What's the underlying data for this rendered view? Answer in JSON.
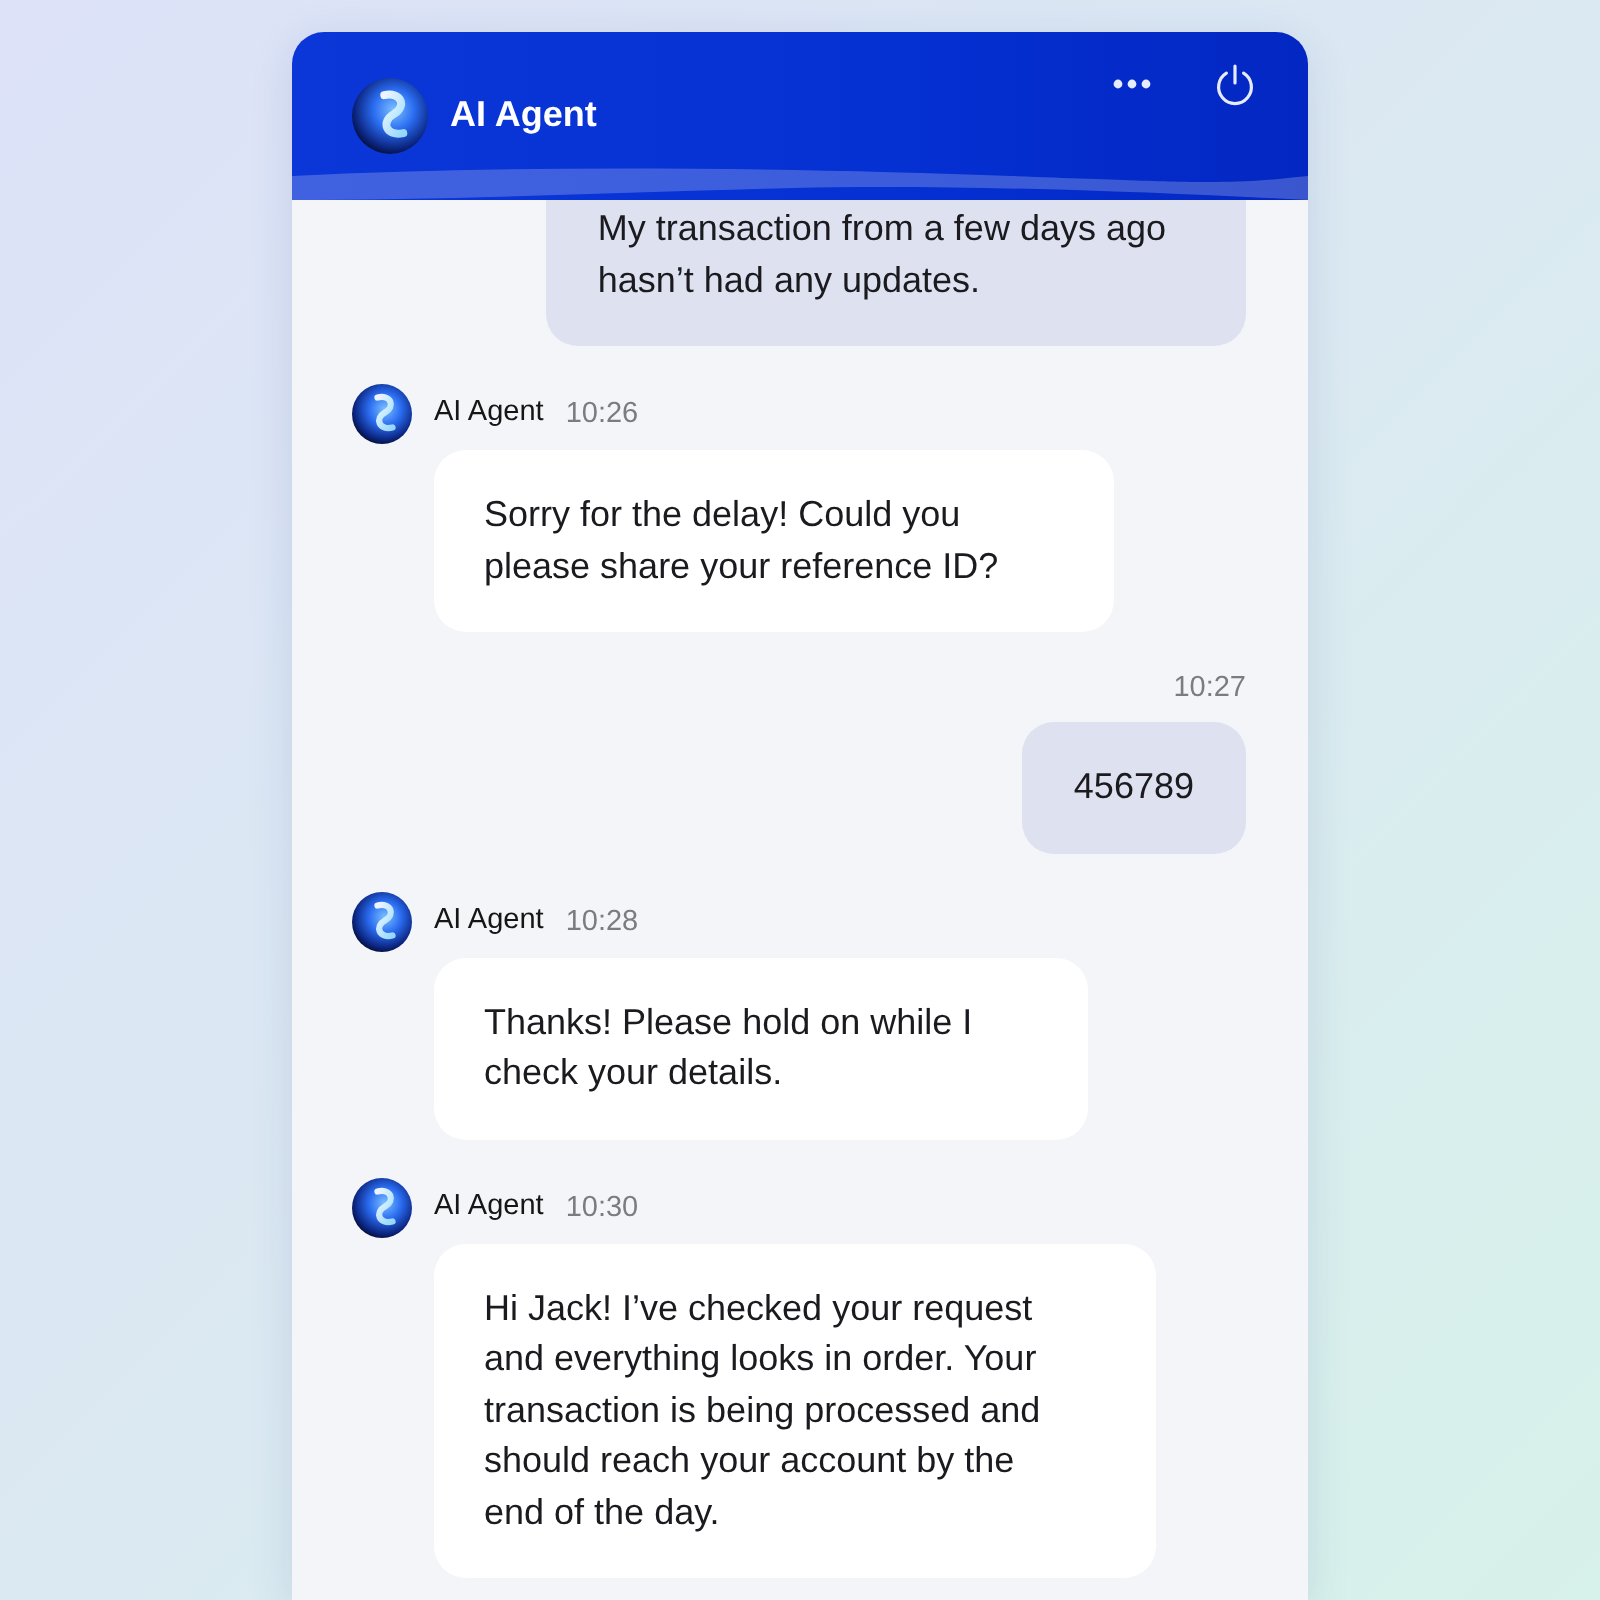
{
  "header": {
    "title": "AI Agent"
  },
  "messages": [
    {
      "kind": "user",
      "text": "My transaction from a few days ago\nhasn’t had any updates."
    },
    {
      "kind": "agent",
      "sender": "AI Agent",
      "time": "10:26",
      "text": "Sorry for the delay! Could you\nplease share your reference ID?"
    },
    {
      "kind": "user",
      "time": "10:27",
      "text": "456789"
    },
    {
      "kind": "agent",
      "sender": "AI Agent",
      "time": "10:28",
      "text": "Thanks! Please hold on while I\ncheck your details."
    },
    {
      "kind": "agent",
      "sender": "AI Agent",
      "time": "10:30",
      "text": "Hi Jack! I’ve checked your request\nand everything looks in order. Your\ntransaction is being processed and\nshould reach your account by the\nend of the day."
    }
  ]
}
